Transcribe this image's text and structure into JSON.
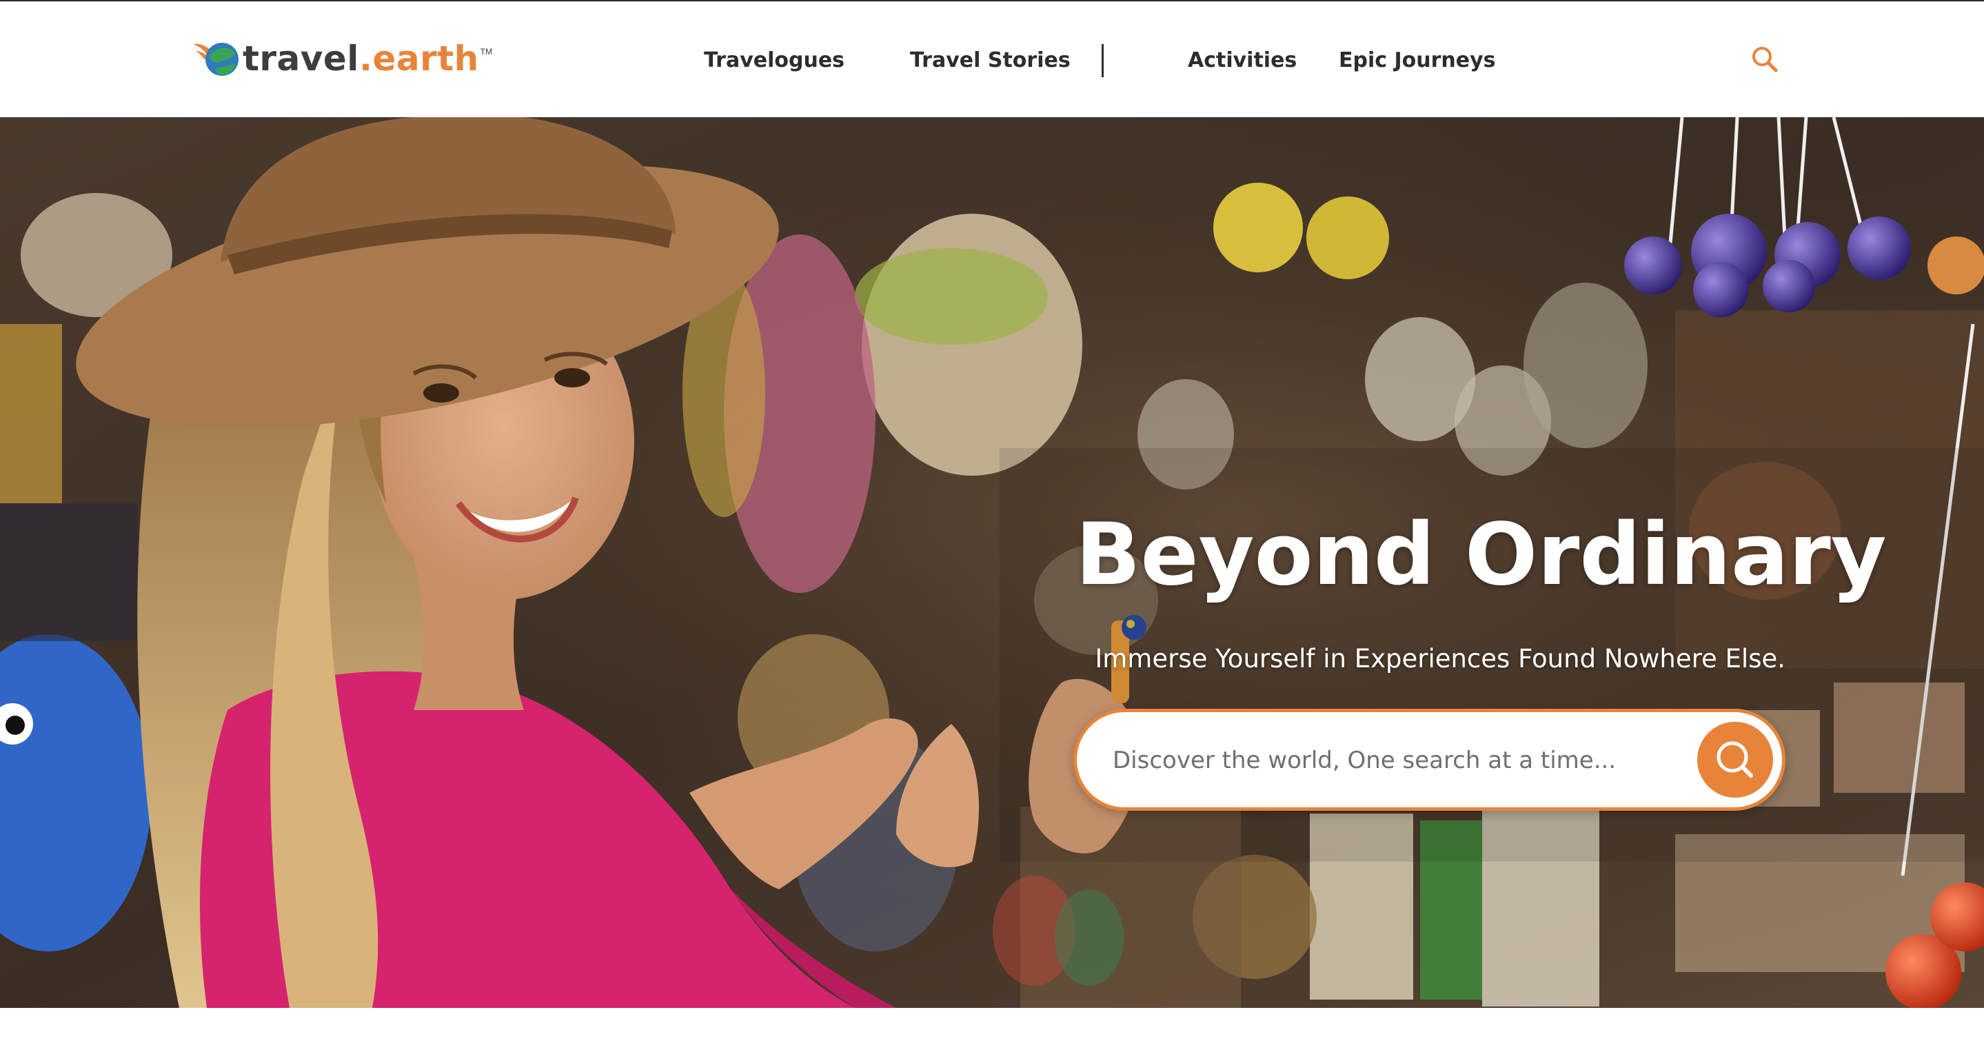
{
  "header": {
    "logo": {
      "brand_part_a": "travel",
      "brand_part_b": ".earth",
      "trademark": "TM"
    },
    "nav": [
      {
        "label": "Travelogues"
      },
      {
        "label": "Travel Stories"
      },
      {
        "label": "Activities"
      },
      {
        "label": "Epic Journeys"
      }
    ],
    "search_icon": "search-icon"
  },
  "hero": {
    "title": "Beyond Ordinary",
    "subtitle": "Immerse Yourself in Experiences Found Nowhere Else.",
    "search": {
      "placeholder": "Discover the world, One search at a time...",
      "value": "",
      "button_icon": "search-icon"
    }
  },
  "colors": {
    "accent": "#e8843a",
    "logo_green": "#3aa35a",
    "logo_blue": "#2e7bbf",
    "nav_text": "#2d2d2d"
  }
}
